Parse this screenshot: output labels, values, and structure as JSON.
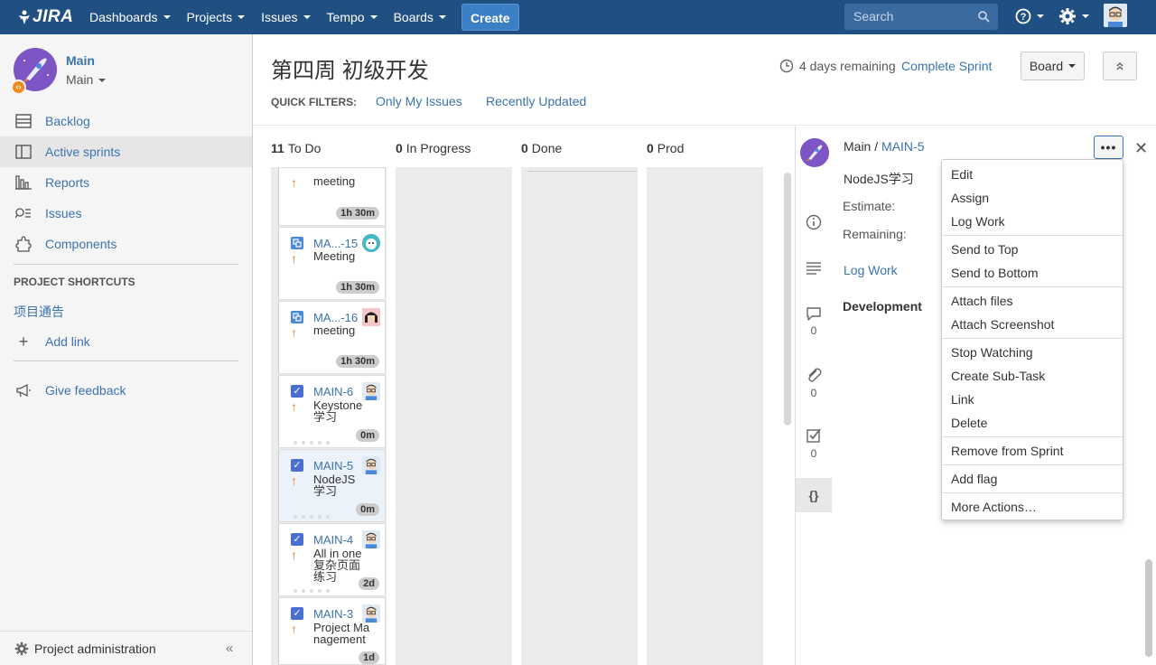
{
  "topnav": {
    "logo": "JIRA",
    "items": [
      "Dashboards",
      "Projects",
      "Issues",
      "Tempo",
      "Boards"
    ],
    "create": "Create",
    "search_placeholder": "Search"
  },
  "sidebar": {
    "project_name": "Main",
    "project_switch": "Main",
    "nav": [
      "Backlog",
      "Active sprints",
      "Reports",
      "Issues",
      "Components"
    ],
    "shortcuts_header": "PROJECT SHORTCUTS",
    "shortcut_link": "项目通告",
    "add_link": "Add link",
    "feedback": "Give feedback",
    "admin": "Project administration",
    "collapse": "«"
  },
  "board": {
    "title": "第四周 初级开发",
    "quick_filters_label": "QUICK FILTERS:",
    "filters": [
      "Only My Issues",
      "Recently Updated"
    ],
    "remaining": "4 days remaining",
    "complete": "Complete Sprint",
    "board_btn": "Board",
    "columns": [
      {
        "count": "11",
        "name": "To Do"
      },
      {
        "count": "0",
        "name": "In Progress"
      },
      {
        "count": "0",
        "name": "Done"
      },
      {
        "count": "0",
        "name": "Prod"
      }
    ],
    "cards": [
      {
        "key": "",
        "summary": "meeting",
        "time": "1h 30m"
      },
      {
        "key": "MA...-15",
        "summary": "Meeting",
        "time": "1h 30m"
      },
      {
        "key": "MA...-16",
        "summary": "meeting",
        "time": "1h 30m"
      },
      {
        "key": "MAIN-6",
        "summary": "Keystone 学习",
        "time": "0m"
      },
      {
        "key": "MAIN-5",
        "summary": "NodeJS 学习",
        "time": "0m"
      },
      {
        "key": "MAIN-4",
        "summary": "All in one 复杂页面练习",
        "time": "2d"
      },
      {
        "key": "MAIN-3",
        "summary": "Project Management",
        "time": "1d"
      }
    ]
  },
  "detail": {
    "crumb_project": "Main",
    "crumb_sep": "/",
    "crumb_issue": "MAIN-5",
    "summary": "NodeJS学习",
    "estimate_label": "Estimate:",
    "remaining_label": "Remaining:",
    "log_work": "Log Work",
    "development": "Development",
    "counts": [
      "0",
      "0",
      "0"
    ],
    "more": "•••"
  },
  "menu": {
    "items": [
      "Edit",
      "Assign",
      "Log Work",
      "Send to Top",
      "Send to Bottom",
      "Attach files",
      "Attach Screenshot",
      "Stop Watching",
      "Create Sub-Task",
      "Link",
      "Delete",
      "Remove from Sprint",
      "Add flag",
      "More Actions…"
    ]
  },
  "colors": {
    "topbar": "#205081",
    "link": "#3b73af",
    "priority": "#e87c24"
  }
}
